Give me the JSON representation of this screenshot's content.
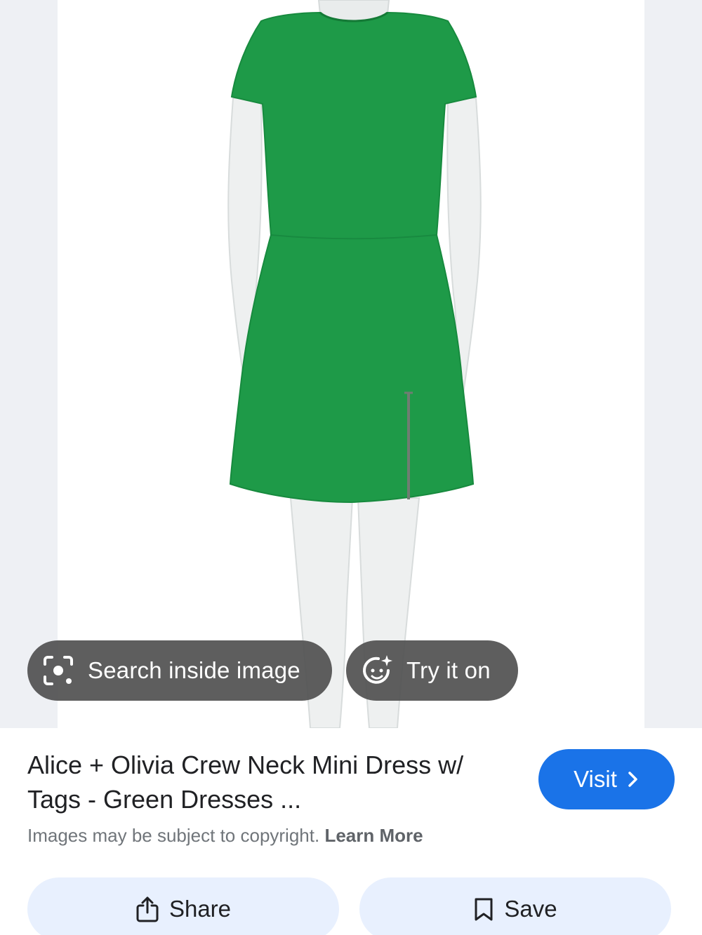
{
  "image_overlay": {
    "search_inside_label": "Search inside image",
    "try_it_on_label": "Try it on"
  },
  "result": {
    "title": "Alice + Olivia Crew Neck Mini Dress w/ Tags - Green Dresses ...",
    "visit_label": "Visit",
    "copyright_text": "Images may be subject to copyright.",
    "learn_more_label": "Learn More"
  },
  "actions": {
    "share_label": "Share",
    "save_label": "Save"
  },
  "icons": {
    "search_inside": "lens-icon",
    "try_it_on": "face-sparkle-icon",
    "visit": "chevron-right-icon",
    "share": "share-icon",
    "save": "bookmark-icon"
  },
  "colors": {
    "dress": "#1e9a48",
    "visit_button": "#1a73e8",
    "action_button": "#e8f0fe",
    "overlay_button": "#505050"
  }
}
